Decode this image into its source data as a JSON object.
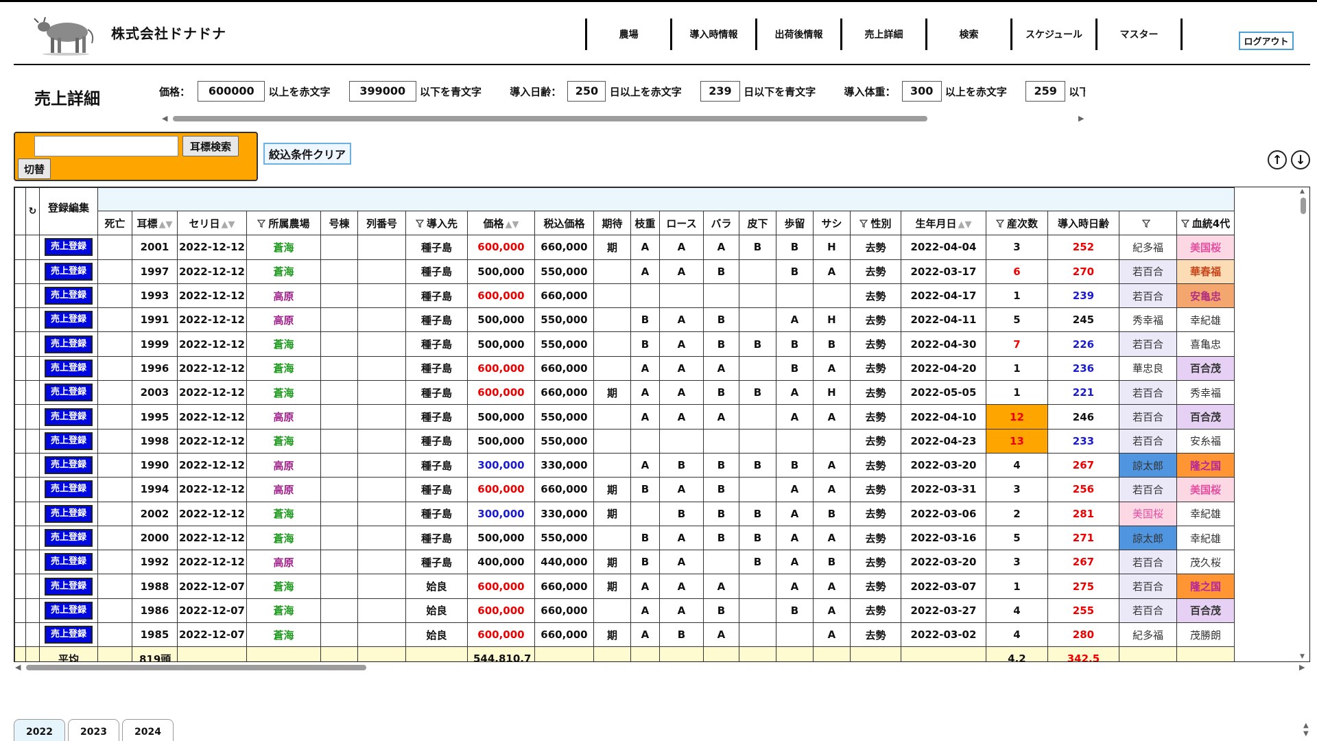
{
  "header": {
    "company": "株式会社ドナドナ",
    "nav": [
      "農場",
      "導入時情報",
      "出荷後情報",
      "売上詳細",
      "検索",
      "スケジュール",
      "マスター"
    ],
    "logout": "ログアウト"
  },
  "page": {
    "title": "売上詳細"
  },
  "filters": [
    {
      "label": "価格：",
      "hi": "600000",
      "hi_suffix": "以上を赤文字",
      "lo": "399000",
      "lo_suffix": "以下を青文字"
    },
    {
      "label": "導入日齢：",
      "hi": "250",
      "hi_suffix": "日以上を赤文字",
      "lo": "239",
      "lo_suffix": "日以下を青文字"
    },
    {
      "label": "導入体重：",
      "hi": "300",
      "hi_suffix": "以上を赤文字",
      "lo": "259",
      "lo_suffix": "以下"
    }
  ],
  "search": {
    "button": "耳標検索",
    "toggle": "切替",
    "clear": "絞込条件クリア",
    "input_value": ""
  },
  "table": {
    "reset_icon": "↻",
    "edit_header": "登録編集",
    "headers": [
      "死亡",
      "耳標",
      "セリ日",
      "所属農場",
      "号棟",
      "列番号",
      "導入先",
      "価格",
      "税込価格",
      "期待",
      "枝重",
      "ロース",
      "バラ",
      "皮下",
      "歩留",
      "サシ",
      "性別",
      "生年月日",
      "産次数",
      "導入時日齢",
      "",
      "血統4代"
    ],
    "register_label": "売上登録",
    "rows": [
      [
        "",
        "2001",
        "2022-12-12",
        "蒼海",
        "",
        "",
        "種子島",
        "600,000",
        "660,000",
        "期",
        "A",
        "A",
        "A",
        "B",
        "B",
        "H",
        "去勢",
        "2022-04-04",
        "3",
        "252",
        "紀多福",
        "美国桜"
      ],
      [
        "",
        "1997",
        "2022-12-12",
        "蒼海",
        "",
        "",
        "種子島",
        "500,000",
        "550,000",
        "",
        "A",
        "A",
        "B",
        "",
        "B",
        "A",
        "去勢",
        "2022-03-17",
        "6",
        "270",
        "若百合",
        "華春福"
      ],
      [
        "",
        "1993",
        "2022-12-12",
        "高原",
        "",
        "",
        "種子島",
        "600,000",
        "660,000",
        "",
        "",
        "",
        "",
        "",
        "",
        "",
        "去勢",
        "2022-04-17",
        "1",
        "239",
        "若百合",
        "安亀忠"
      ],
      [
        "",
        "1991",
        "2022-12-12",
        "高原",
        "",
        "",
        "種子島",
        "500,000",
        "550,000",
        "",
        "B",
        "A",
        "B",
        "",
        "A",
        "H",
        "去勢",
        "2022-04-11",
        "5",
        "245",
        "秀幸福",
        "幸紀雄"
      ],
      [
        "",
        "1999",
        "2022-12-12",
        "蒼海",
        "",
        "",
        "種子島",
        "500,000",
        "550,000",
        "",
        "B",
        "A",
        "B",
        "B",
        "B",
        "B",
        "去勢",
        "2022-04-30",
        "7",
        "226",
        "若百合",
        "喜亀忠"
      ],
      [
        "",
        "1996",
        "2022-12-12",
        "蒼海",
        "",
        "",
        "種子島",
        "600,000",
        "660,000",
        "",
        "A",
        "A",
        "A",
        "",
        "B",
        "A",
        "去勢",
        "2022-04-20",
        "1",
        "236",
        "華忠良",
        "百合茂"
      ],
      [
        "",
        "2003",
        "2022-12-12",
        "蒼海",
        "",
        "",
        "種子島",
        "600,000",
        "660,000",
        "期",
        "A",
        "A",
        "B",
        "B",
        "A",
        "H",
        "去勢",
        "2022-05-05",
        "1",
        "221",
        "若百合",
        "秀幸福"
      ],
      [
        "",
        "1995",
        "2022-12-12",
        "高原",
        "",
        "",
        "種子島",
        "500,000",
        "550,000",
        "",
        "A",
        "A",
        "A",
        "",
        "A",
        "A",
        "去勢",
        "2022-04-10",
        "12",
        "246",
        "若百合",
        "百合茂"
      ],
      [
        "",
        "1998",
        "2022-12-12",
        "蒼海",
        "",
        "",
        "種子島",
        "500,000",
        "550,000",
        "",
        "",
        "",
        "",
        "",
        "",
        "",
        "去勢",
        "2022-04-23",
        "13",
        "233",
        "若百合",
        "安糸福"
      ],
      [
        "",
        "1990",
        "2022-12-12",
        "高原",
        "",
        "",
        "種子島",
        "300,000",
        "330,000",
        "",
        "A",
        "B",
        "B",
        "B",
        "B",
        "A",
        "去勢",
        "2022-03-20",
        "4",
        "267",
        "諒太郎",
        "隆之国"
      ],
      [
        "",
        "1994",
        "2022-12-12",
        "高原",
        "",
        "",
        "種子島",
        "600,000",
        "660,000",
        "期",
        "B",
        "A",
        "B",
        "",
        "A",
        "A",
        "去勢",
        "2022-03-31",
        "3",
        "256",
        "若百合",
        "美国桜"
      ],
      [
        "",
        "2002",
        "2022-12-12",
        "蒼海",
        "",
        "",
        "種子島",
        "300,000",
        "330,000",
        "期",
        "",
        "B",
        "B",
        "B",
        "A",
        "B",
        "去勢",
        "2022-03-06",
        "2",
        "281",
        "美国桜",
        "幸紀雄"
      ],
      [
        "",
        "2000",
        "2022-12-12",
        "蒼海",
        "",
        "",
        "種子島",
        "500,000",
        "550,000",
        "",
        "B",
        "A",
        "B",
        "B",
        "A",
        "A",
        "去勢",
        "2022-03-16",
        "5",
        "271",
        "諒太郎",
        "幸紀雄"
      ],
      [
        "",
        "1992",
        "2022-12-12",
        "高原",
        "",
        "",
        "種子島",
        "400,000",
        "440,000",
        "期",
        "B",
        "A",
        "",
        "B",
        "A",
        "B",
        "去勢",
        "2022-03-20",
        "3",
        "267",
        "若百合",
        "茂久桜"
      ],
      [
        "",
        "1988",
        "2022-12-07",
        "蒼海",
        "",
        "",
        "姶良",
        "600,000",
        "660,000",
        "期",
        "A",
        "A",
        "A",
        "",
        "A",
        "A",
        "去勢",
        "2022-03-07",
        "1",
        "275",
        "若百合",
        "隆之国"
      ],
      [
        "",
        "1986",
        "2022-12-07",
        "蒼海",
        "",
        "",
        "姶良",
        "600,000",
        "660,000",
        "",
        "A",
        "A",
        "B",
        "",
        "B",
        "A",
        "去勢",
        "2022-03-27",
        "4",
        "255",
        "若百合",
        "百合茂"
      ],
      [
        "",
        "1985",
        "2022-12-07",
        "蒼海",
        "",
        "",
        "姶良",
        "600,000",
        "660,000",
        "期",
        "A",
        "B",
        "A",
        "",
        "",
        "A",
        "去勢",
        "2022-03-02",
        "4",
        "280",
        "紀多福",
        "茂勝朗"
      ]
    ],
    "footer": {
      "label": "平均",
      "count": "819頭",
      "price_avg": "544,810.7",
      "parity_avg": "4.2",
      "age_avg": "342.5"
    }
  },
  "tabs": [
    "2022",
    "2023",
    "2024"
  ],
  "colors": {
    "red": "#ee0000",
    "blue": "#1a1ad0",
    "orange": "#ffa500",
    "register_btn": "#0008e0",
    "header_bg": "#eaf6fc",
    "footer_bg": "#fffbd1"
  }
}
